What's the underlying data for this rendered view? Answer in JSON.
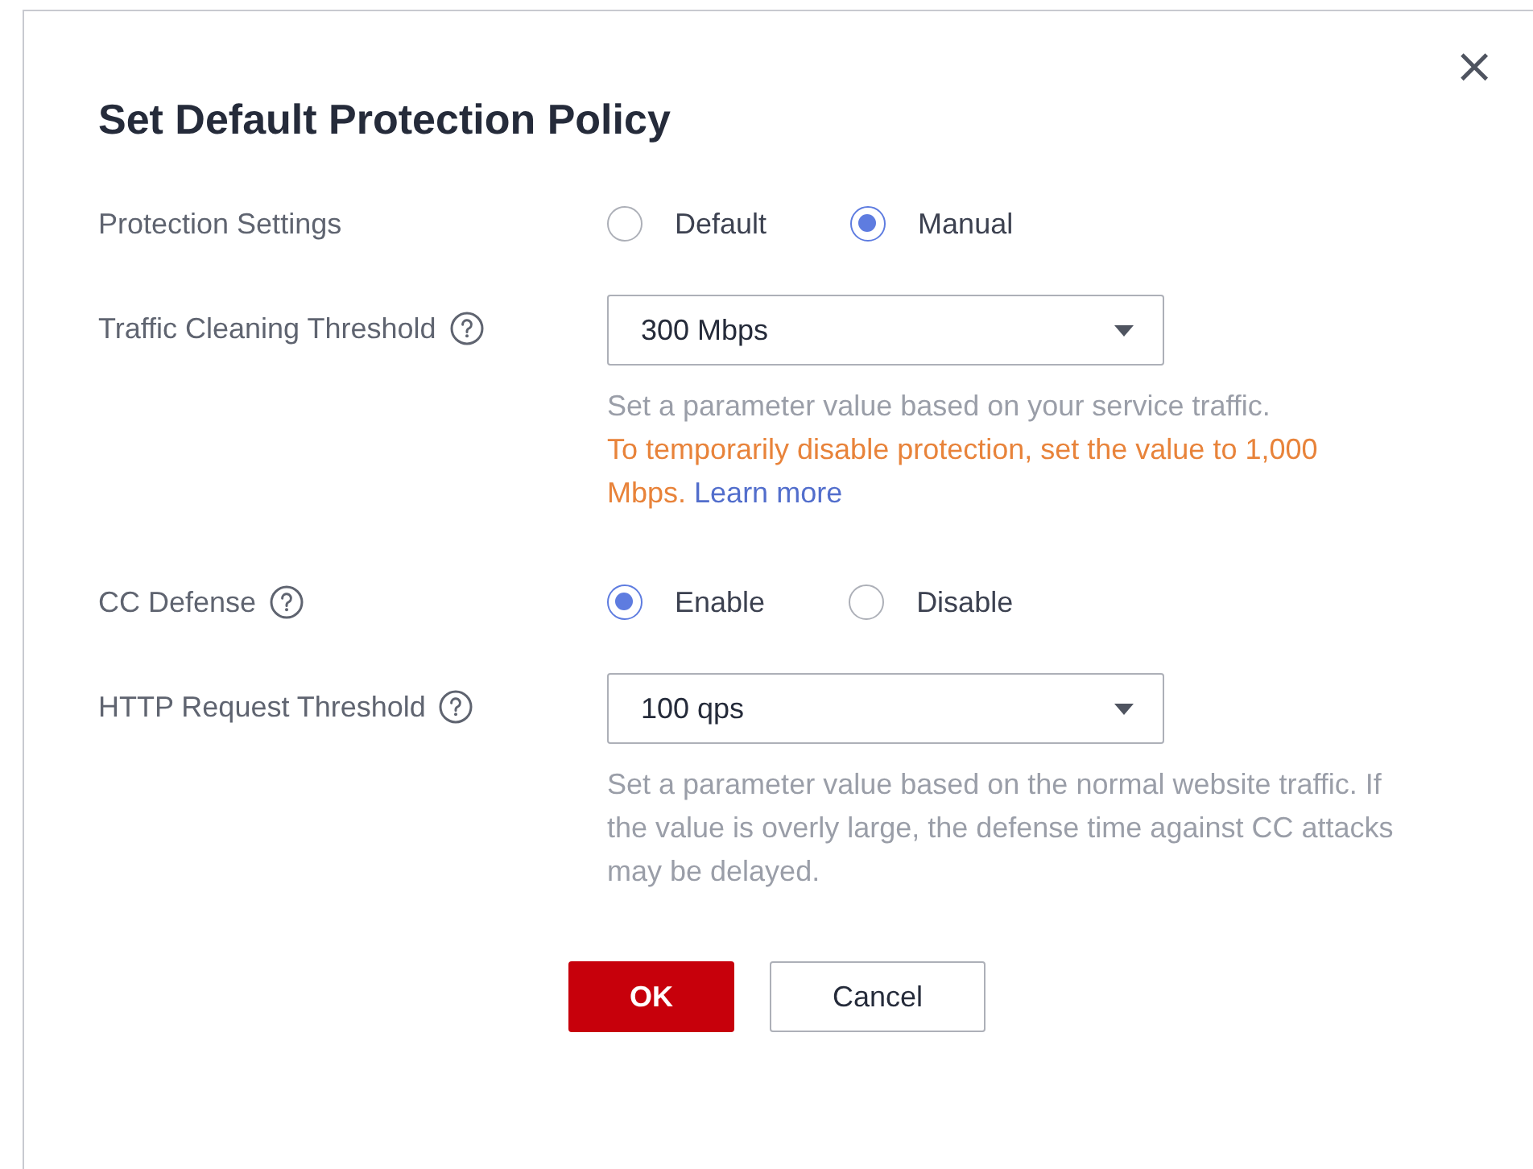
{
  "dialog": {
    "title": "Set Default Protection Policy",
    "close": "×"
  },
  "fields": [
    {
      "kind": "radio",
      "label": "Protection Settings",
      "help_icon": false,
      "options": [
        {
          "label": "Default",
          "selected": false
        },
        {
          "label": "Manual",
          "selected": true
        }
      ]
    },
    {
      "kind": "select",
      "label": "Traffic Cleaning Threshold",
      "help_icon": true,
      "value": "300 Mbps",
      "hints": [
        {
          "kind": "note",
          "text": "Set a parameter value based on your service traffic."
        },
        {
          "kind": "warning",
          "text": "To temporarily disable protection, set the value to 1,000 Mbps.",
          "link": "Learn more"
        }
      ]
    },
    {
      "kind": "radio",
      "label": "CC Defense",
      "help_icon": true,
      "options": [
        {
          "label": "Enable",
          "selected": true
        },
        {
          "label": "Disable",
          "selected": false
        }
      ]
    },
    {
      "kind": "select",
      "label": "HTTP Request Threshold",
      "help_icon": true,
      "value": "100 qps",
      "hints": [
        {
          "kind": "note",
          "text": "Set a parameter value based on the normal website traffic. If the value is overly large, the defense time against CC attacks may be delayed."
        }
      ]
    }
  ],
  "buttons": [
    {
      "label": "OK",
      "kind": "primary"
    },
    {
      "label": "Cancel",
      "kind": "secondary"
    }
  ]
}
